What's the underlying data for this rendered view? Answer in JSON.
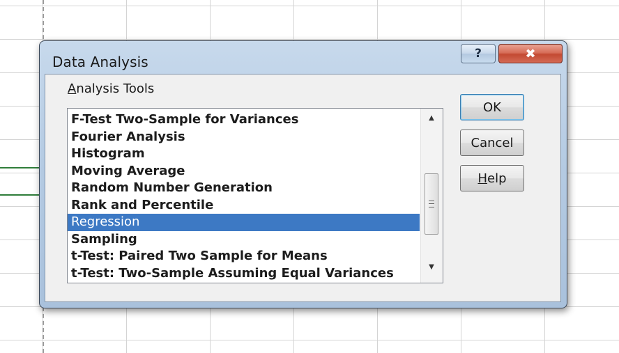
{
  "dialog": {
    "title": "Data Analysis",
    "title_help_glyph": "?",
    "title_close_glyph": "✖"
  },
  "analysis_tools": {
    "label_mnemonic": "A",
    "label_rest": "nalysis Tools",
    "items": [
      "F-Test Two-Sample for Variances",
      "Fourier Analysis",
      "Histogram",
      "Moving Average",
      "Random Number Generation",
      "Rank and Percentile",
      "Regression",
      "Sampling",
      "t-Test: Paired Two Sample for Means",
      "t-Test: Two-Sample Assuming Equal Variances"
    ],
    "selected": "Regression",
    "scroll_up_glyph": "▲",
    "scroll_down_glyph": "▼"
  },
  "buttons": {
    "ok": "OK",
    "cancel": "Cancel",
    "help_mnemonic": "H",
    "help_rest": "elp"
  },
  "colors": {
    "selection": "#3d79c4",
    "dialog_frame": "#b5cbe3",
    "close_button": "#c34a33",
    "gridline_green": "#2f7d3a"
  }
}
